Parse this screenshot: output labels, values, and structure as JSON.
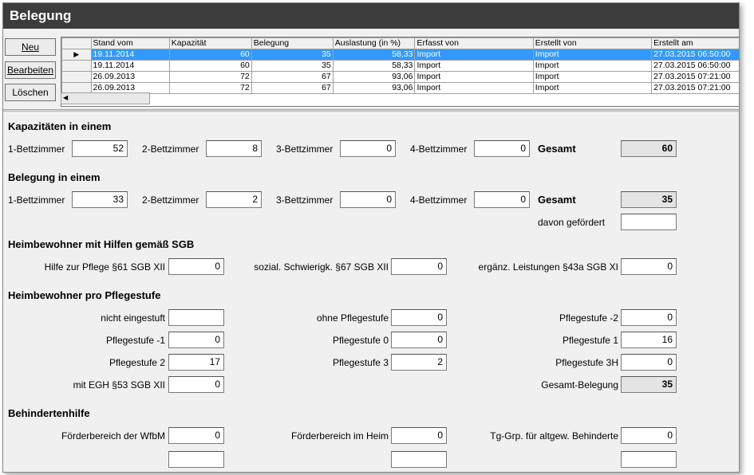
{
  "window": {
    "title": "Belegung"
  },
  "buttons": {
    "neu": "Neu",
    "bearbeiten": "Bearbeiten",
    "loeschen": "Löschen"
  },
  "grid": {
    "columns": [
      "Stand vom",
      "Kapazität",
      "Belegung",
      "Auslastung (in %)",
      "Erfasst von",
      "Erstellt von",
      "Erstellt am"
    ],
    "rows": [
      [
        "19.11.2014",
        "60",
        "35",
        "58,33",
        "Import",
        "Import",
        "27.03.2015 06:50:00"
      ],
      [
        "19.11.2014",
        "60",
        "35",
        "58,33",
        "Import",
        "Import",
        "27.03.2015 06:50:00"
      ],
      [
        "26.09.2013",
        "72",
        "67",
        "93,06",
        "Import",
        "Import",
        "27.03.2015 07:21:00"
      ],
      [
        "26.09.2013",
        "72",
        "67",
        "93,06",
        "Import",
        "Import",
        "27.03.2015 07:21:00"
      ]
    ]
  },
  "kapazitaet": {
    "heading": "Kapazitäten in einem",
    "labels": [
      "1-Bettzimmer",
      "2-Bettzimmer",
      "3-Bettzimmer",
      "4-Bettzimmer"
    ],
    "values": [
      "52",
      "8",
      "0",
      "0"
    ],
    "gesamt_label": "Gesamt",
    "gesamt_value": "60"
  },
  "belegung": {
    "heading": "Belegung in einem",
    "labels": [
      "1-Bettzimmer",
      "2-Bettzimmer",
      "3-Bettzimmer",
      "4-Bettzimmer"
    ],
    "values": [
      "33",
      "2",
      "0",
      "0"
    ],
    "gesamt_label": "Gesamt",
    "gesamt_value": "35",
    "gefoerdert_label": "davon gefördert",
    "gefoerdert_value": ""
  },
  "hilfen": {
    "heading": "Heimbewohner mit Hilfen gemäß SGB",
    "labels": [
      "Hilfe zur Pflege §61 SGB XII",
      "sozial. Schwierigk. §67 SGB XII",
      "ergänz. Leistungen §43a SGB XI"
    ],
    "values": [
      "0",
      "0",
      "0"
    ]
  },
  "pflegestufe": {
    "heading": "Heimbewohner pro Pflegestufe",
    "labels": [
      "nicht eingestuft",
      "ohne Pflegestufe",
      "Pflegestufe -2",
      "Pflegestufe -1",
      "Pflegestufe 0",
      "Pflegestufe 1",
      "Pflegestufe 2",
      "Pflegestufe 3",
      "Pflegestufe 3H",
      "mit EGH §53 SGB XII",
      "Gesamt-Belegung"
    ],
    "values": [
      "",
      "0",
      "0",
      "0",
      "0",
      "16",
      "17",
      "2",
      "0",
      "0",
      "35"
    ]
  },
  "behindertenhilfe": {
    "heading": "Behindertenhilfe",
    "labels": [
      "Förderbereich der WfbM",
      "Förderbereich im Heim",
      "Tg-Grp. für altgew. Behinderte"
    ],
    "values": [
      "0",
      "0",
      "0"
    ]
  }
}
